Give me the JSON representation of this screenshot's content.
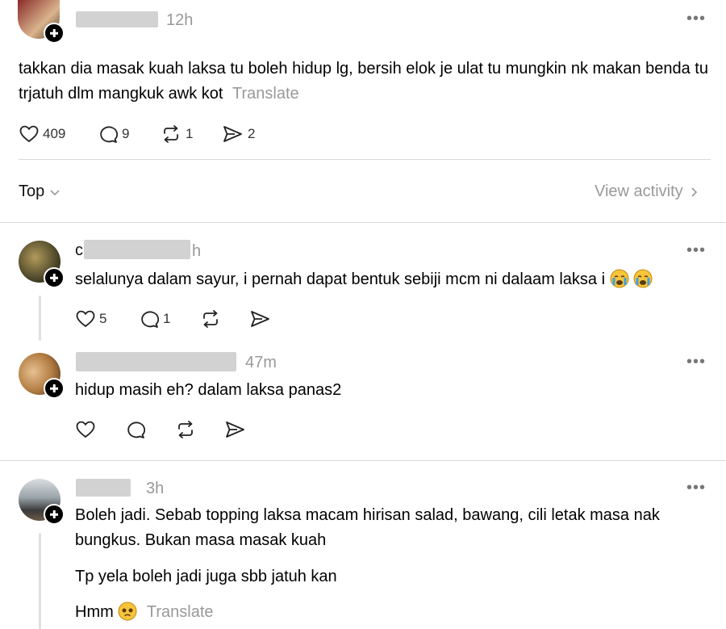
{
  "post": {
    "time": "12h",
    "text": "takkan dia masak kuah laksa tu boleh hidup lg, bersih elok je ulat tu mungkin nk makan benda tu trjatuh dlm mangkuk awk kot",
    "translate": "Translate",
    "likes": "409",
    "replies": "9",
    "reposts": "1",
    "shares": "2"
  },
  "sort": {
    "label": "Top",
    "view_activity": "View activity"
  },
  "comments": [
    {
      "time": "h",
      "text": "selalunya dalam sayur, i pernah dapat bentuk sebiji mcm ni dalaam laksa i",
      "likes": "5",
      "replies": "1"
    },
    {
      "time": "47m",
      "text": "hidup masih eh? dalam laksa panas2"
    },
    {
      "time": "3h",
      "text1": "Boleh jadi. Sebab topping laksa macam hirisan salad, bawang, cili letak masa nak bungkus. Bukan masa masak kuah",
      "text2": "Tp yela boleh jadi juga sbb jatuh kan",
      "text3": "Hmm",
      "translate": "Translate"
    }
  ],
  "icons": {
    "more": "more-icon",
    "like": "heart-icon",
    "reply": "comment-icon",
    "repost": "repost-icon",
    "share": "share-icon",
    "chevron": "chevron-icon"
  }
}
